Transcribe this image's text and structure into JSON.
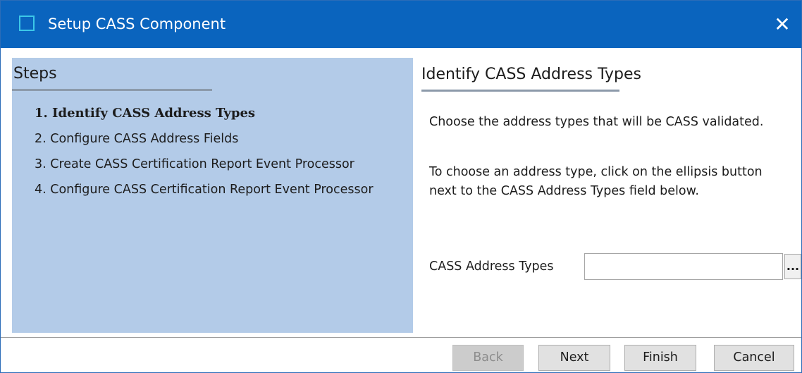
{
  "window": {
    "title": "Setup CASS Component",
    "close_glyph": "✕"
  },
  "steps": {
    "heading": "Steps",
    "items": [
      {
        "label": "1. Identify CASS Address Types",
        "active": true
      },
      {
        "label": "2. Configure CASS Address Fields",
        "active": false
      },
      {
        "label": "3. Create CASS Certification Report Event Processor",
        "active": false
      },
      {
        "label": "4. Configure CASS Certification Report Event Processor",
        "active": false
      }
    ]
  },
  "content": {
    "heading": "Identify CASS Address Types",
    "description": "Choose the address types that will be CASS validated.",
    "instruction_line1": "To choose an address type, click on the ellipsis button",
    "instruction_line2": "next to the CASS Address Types field below.",
    "field": {
      "label": "CASS Address Types",
      "value": "",
      "ellipsis_label": "..."
    }
  },
  "buttons": {
    "back": {
      "label": "Back",
      "enabled": false
    },
    "next": {
      "label": "Next",
      "enabled": true
    },
    "finish": {
      "label": "Finish",
      "enabled": true
    },
    "cancel": {
      "label": "Cancel",
      "enabled": true
    }
  },
  "colors": {
    "titlebar": "#0a64be",
    "steps_panel": "#b3cbe8",
    "icon_border": "#3cc8e8"
  }
}
